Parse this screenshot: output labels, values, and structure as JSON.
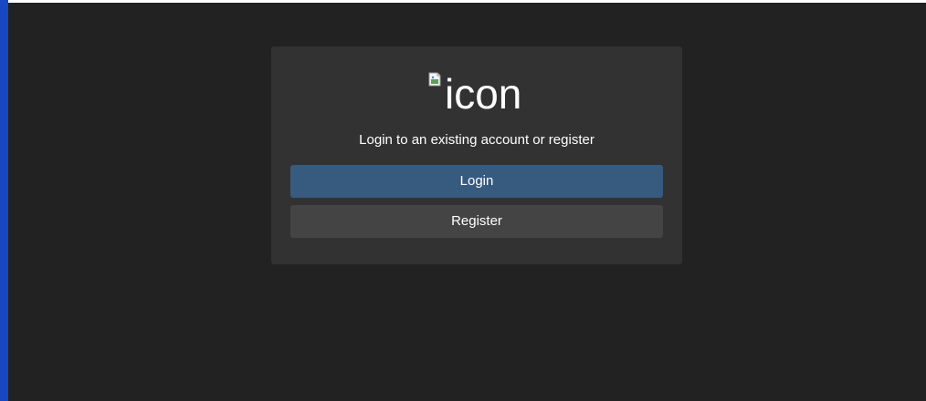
{
  "login_card": {
    "icon_alt_text": "icon",
    "prompt": "Login to an existing account or register",
    "login_label": "Login",
    "register_label": "Register"
  },
  "colors": {
    "background": "#222222",
    "card": "#323232",
    "login_button": "#375a7f",
    "register_button": "#444444",
    "left_edge": "#1847c2"
  },
  "icons": {
    "app_icon": "broken-image-icon"
  }
}
